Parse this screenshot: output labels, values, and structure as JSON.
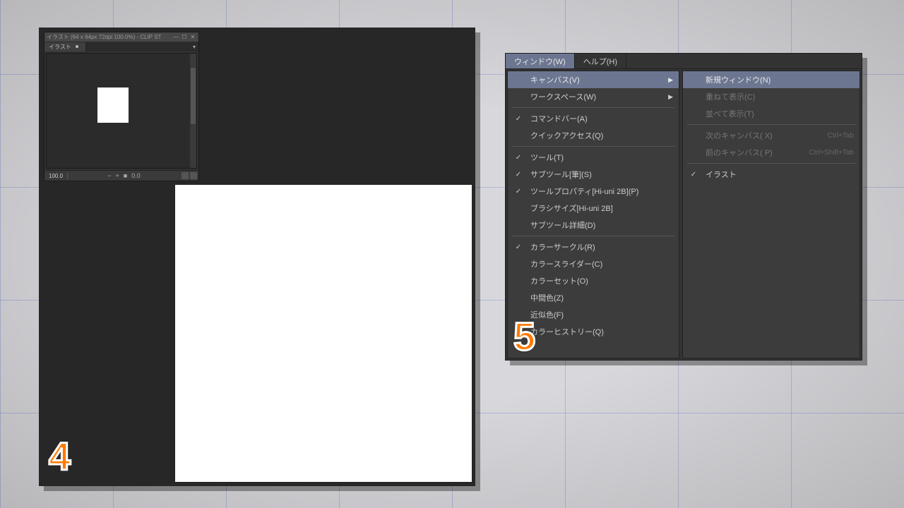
{
  "navigator": {
    "title": "イラスト    (64 x 64px  72dpi  100.0%)  - CLIP ST",
    "tab_label": "イラスト",
    "zoom_left": "100.0",
    "zoom_right": "0.0"
  },
  "menu": {
    "tabs": [
      {
        "label": "ウィンドウ(W)",
        "active": true
      },
      {
        "label": "ヘルプ(H)",
        "active": false
      }
    ],
    "left_items": [
      {
        "label": "キャンバス(V)",
        "arrow": true,
        "selected": true
      },
      {
        "label": "ワークスペース(W)",
        "arrow": true
      },
      {
        "sep": true
      },
      {
        "label": "コマンドバー(A)",
        "checked": true
      },
      {
        "label": "クイックアクセス(Q)"
      },
      {
        "sep": true
      },
      {
        "label": "ツール(T)",
        "checked": true
      },
      {
        "label": "サブツール[筆](S)",
        "checked": true
      },
      {
        "label": "ツールプロパティ[Hi-uni 2B](P)",
        "checked": true
      },
      {
        "label": "ブラシサイズ[Hi-uni 2B]"
      },
      {
        "label": "サブツール詳細(D)"
      },
      {
        "sep": true
      },
      {
        "label": "カラーサークル(R)",
        "checked": true
      },
      {
        "label": "カラースライダー(C)"
      },
      {
        "label": "カラーセット(O)"
      },
      {
        "label": "中間色(Z)"
      },
      {
        "label": "近似色(F)"
      },
      {
        "label": "カラーヒストリー(Q)"
      }
    ],
    "right_items": [
      {
        "label": "新規ウィンドウ(N)",
        "selected": true
      },
      {
        "label": "重ねて表示(C)",
        "disabled": true
      },
      {
        "label": "並べて表示(T)",
        "disabled": true
      },
      {
        "sep": true
      },
      {
        "label": "次のキャンバス( X)",
        "shortcut": "Ctrl+Tab",
        "disabled": true
      },
      {
        "label": "前のキャンバス( P)",
        "shortcut": "Ctrl+Shift+Tab",
        "disabled": true
      },
      {
        "sep": true
      },
      {
        "label": "イラスト",
        "checked": true
      }
    ]
  },
  "steps": {
    "s4": "4",
    "s5": "5"
  }
}
